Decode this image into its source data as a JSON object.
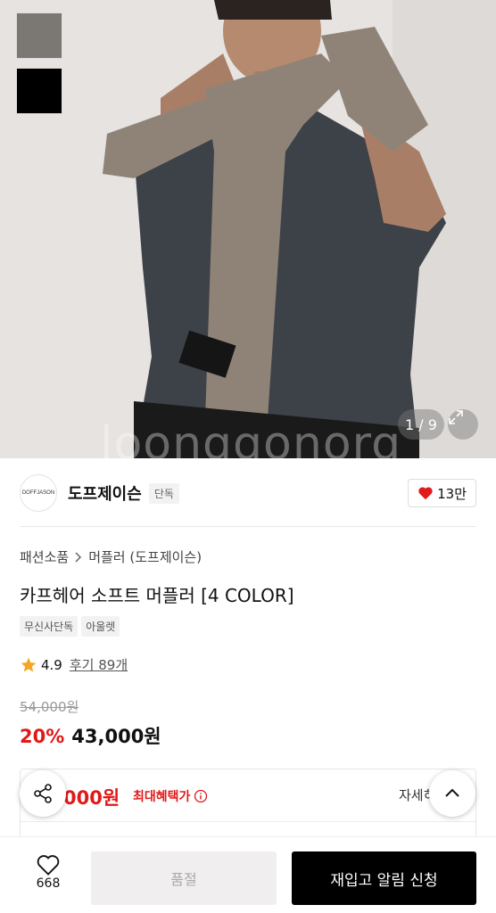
{
  "gallery": {
    "counter": "1 / 9",
    "watermark": "loonggonorg",
    "swatches": [
      "gray",
      "black"
    ]
  },
  "brand": {
    "logo_text": "DOFFJASON",
    "name": "도프제이슨",
    "badge": "단독",
    "likes": "13만"
  },
  "breadcrumb": {
    "category": "패션소품",
    "subcategory": "머플러 (도프제이슨)"
  },
  "product": {
    "title": "카프헤어 소프트 머플러 [4 COLOR]",
    "tags": [
      "무신사단독",
      "아울렛"
    ],
    "rating": "4.9",
    "review_text": "후기 89개"
  },
  "price": {
    "original": "54,000원",
    "discount": "20%",
    "sale": "43,000원"
  },
  "benefit": {
    "price": "000원",
    "label": "최대혜택가",
    "detail": "자세히"
  },
  "bottom": {
    "wish_count": "668",
    "soldout_label": "품절",
    "restock_label": "재입고 알림 신청"
  },
  "colors": {
    "accent_red": "#e0191a",
    "black": "#000000"
  }
}
